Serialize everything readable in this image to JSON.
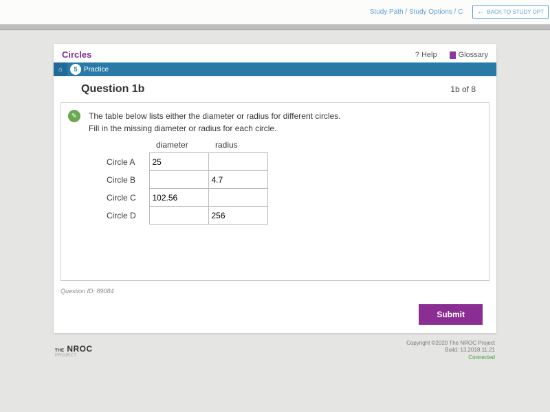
{
  "top": {
    "breadcrumb": "Study Path / Study Options / C",
    "back_label": "BACK TO STUDY OPT"
  },
  "lesson": {
    "title": "Circles"
  },
  "practice": {
    "step": "5",
    "label": "Practice"
  },
  "header": {
    "help": "Help",
    "glossary": "Glossary"
  },
  "question": {
    "title": "Question 1b",
    "counter": "1b of 8",
    "prompt_line1": "The table below lists either the diameter or radius for different circles.",
    "prompt_line2": "Fill in the missing diameter or radius for each circle.",
    "id_label": "Question ID: 89084"
  },
  "table": {
    "col_diameter": "diameter",
    "col_radius": "radius",
    "rows": {
      "a": {
        "label": "Circle A",
        "diameter": "25",
        "radius": ""
      },
      "b": {
        "label": "Circle B",
        "diameter": "",
        "radius": "4.7"
      },
      "c": {
        "label": "Circle C",
        "diameter": "102.56",
        "radius": ""
      },
      "d": {
        "label": "Circle D",
        "diameter": "",
        "radius": "256"
      }
    }
  },
  "actions": {
    "submit": "Submit"
  },
  "footer": {
    "brand": "NROC",
    "brand_prefix": "THE",
    "brand_suffix": "PROJECT",
    "copyright": "Copyright ©2020 The NROC Project",
    "build": "Build: 13.2018.11.21",
    "status": "Connected"
  }
}
